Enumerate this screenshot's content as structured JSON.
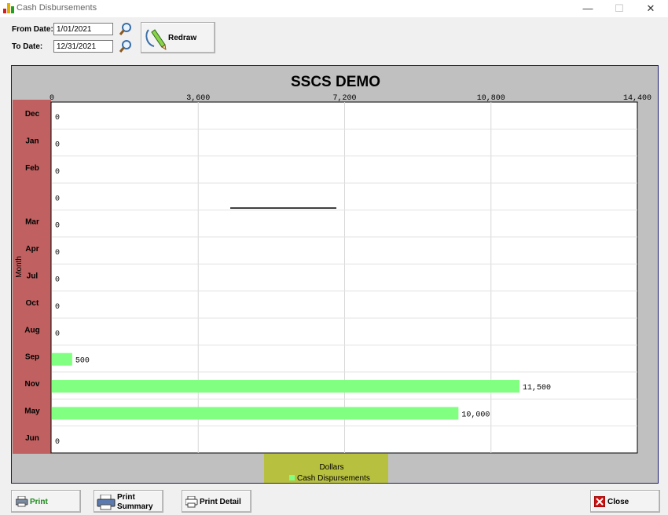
{
  "window": {
    "title": "Cash Disbursements",
    "minimize_icon": "minimize-icon",
    "maximize_icon": "maximize-icon",
    "close_icon": "close-icon"
  },
  "filters": {
    "from_label": "From Date:",
    "from_value": "1/01/2021",
    "to_label": "To Date:",
    "to_value": "12/31/2021",
    "lookup_icon": "magnifier-icon"
  },
  "toolbar": {
    "redraw_label": "Redraw",
    "redraw_icon": "pencil-icon"
  },
  "footer": {
    "print_label": "Print",
    "print_summary_line1": "Print",
    "print_summary_line2": "Summary",
    "print_detail_label": "Print Detail",
    "close_label": "Close"
  },
  "colors": {
    "bar": "#80ff80",
    "category_band": "#c06060",
    "legend_band": "#b8c040",
    "plot_background": "#ffffff",
    "frame_background": "#c0c0c0",
    "close_icon_red": "#cc1111",
    "print_green": "#1a8a1a"
  },
  "chart_data": {
    "type": "bar",
    "orientation": "horizontal",
    "title": "SSCS DEMO",
    "xlabel": "Dollars",
    "ylabel": "Month",
    "xlim": [
      0,
      14400
    ],
    "x_ticks": [
      "0",
      "3,600",
      "7,200",
      "10,800",
      "14,400"
    ],
    "grid": true,
    "legend": "bottom-center",
    "categories": [
      "Dec",
      "Jan",
      "Feb",
      "",
      "Mar",
      "Apr",
      "Jul",
      "Oct",
      "Aug",
      "Sep",
      "Nov",
      "May",
      "Jun"
    ],
    "series": [
      {
        "name": "Cash Dispursements",
        "values": [
          0,
          0,
          0,
          0,
          0,
          0,
          0,
          0,
          0,
          500,
          11500,
          10000,
          0
        ],
        "labels": [
          "0",
          "0",
          "0",
          "0",
          "0",
          "0",
          "0",
          "0",
          "0",
          "500",
          "11,500",
          "10,000",
          "0"
        ]
      }
    ]
  }
}
